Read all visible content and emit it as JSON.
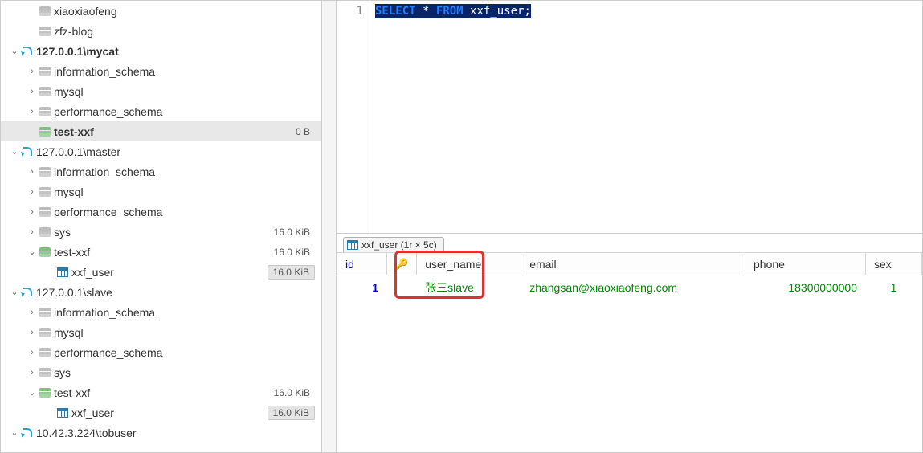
{
  "sidebar": {
    "tree": [
      {
        "indent": 1,
        "caret": "",
        "icon": "db",
        "label": "xiaoxiaofeng"
      },
      {
        "indent": 1,
        "caret": "",
        "icon": "db",
        "label": "zfz-blog"
      },
      {
        "indent": 0,
        "caret": "v",
        "icon": "conn",
        "label": "127.0.0.1\\mycat",
        "bold": true
      },
      {
        "indent": 1,
        "caret": ">",
        "icon": "db",
        "label": "information_schema"
      },
      {
        "indent": 1,
        "caret": ">",
        "icon": "db",
        "label": "mysql"
      },
      {
        "indent": 1,
        "caret": ">",
        "icon": "db",
        "label": "performance_schema"
      },
      {
        "indent": 1,
        "caret": "",
        "icon": "db-green",
        "label": "test-xxf",
        "bold": true,
        "size": "0 B",
        "selected": true
      },
      {
        "indent": 0,
        "caret": "v",
        "icon": "conn",
        "label": "127.0.0.1\\master"
      },
      {
        "indent": 1,
        "caret": ">",
        "icon": "db",
        "label": "information_schema"
      },
      {
        "indent": 1,
        "caret": ">",
        "icon": "db",
        "label": "mysql"
      },
      {
        "indent": 1,
        "caret": ">",
        "icon": "db",
        "label": "performance_schema"
      },
      {
        "indent": 1,
        "caret": ">",
        "icon": "db",
        "label": "sys",
        "size": "16.0 KiB"
      },
      {
        "indent": 1,
        "caret": "v",
        "icon": "db-green",
        "label": "test-xxf",
        "size": "16.0 KiB"
      },
      {
        "indent": 2,
        "caret": "",
        "icon": "table",
        "label": "xxf_user",
        "size": "16.0 KiB",
        "boxed": true
      },
      {
        "indent": 0,
        "caret": "v",
        "icon": "conn",
        "label": "127.0.0.1\\slave"
      },
      {
        "indent": 1,
        "caret": ">",
        "icon": "db",
        "label": "information_schema"
      },
      {
        "indent": 1,
        "caret": ">",
        "icon": "db",
        "label": "mysql"
      },
      {
        "indent": 1,
        "caret": ">",
        "icon": "db",
        "label": "performance_schema"
      },
      {
        "indent": 1,
        "caret": ">",
        "icon": "db",
        "label": "sys"
      },
      {
        "indent": 1,
        "caret": "v",
        "icon": "db-green",
        "label": "test-xxf",
        "size": "16.0 KiB"
      },
      {
        "indent": 2,
        "caret": "",
        "icon": "table",
        "label": "xxf_user",
        "size": "16.0 KiB",
        "boxed": true
      },
      {
        "indent": 0,
        "caret": "v",
        "icon": "conn",
        "label": "10.42.3.224\\tobuser"
      }
    ]
  },
  "editor": {
    "line_no": "1",
    "sql_full": "SELECT * FROM xxf_user;",
    "kw_select": "SELECT",
    "kw_star": "*",
    "kw_from": "FROM",
    "tbl": "xxf_user;"
  },
  "result": {
    "tab_label": "xxf_user (1r × 5c)",
    "headers": {
      "id": "id",
      "user_name": "user_name",
      "email": "email",
      "phone": "phone",
      "sex": "sex"
    },
    "row": {
      "id": "1",
      "user_name": "张三slave",
      "email": "zhangsan@xiaoxiaofeng.com",
      "phone": "18300000000",
      "sex": "1"
    }
  }
}
